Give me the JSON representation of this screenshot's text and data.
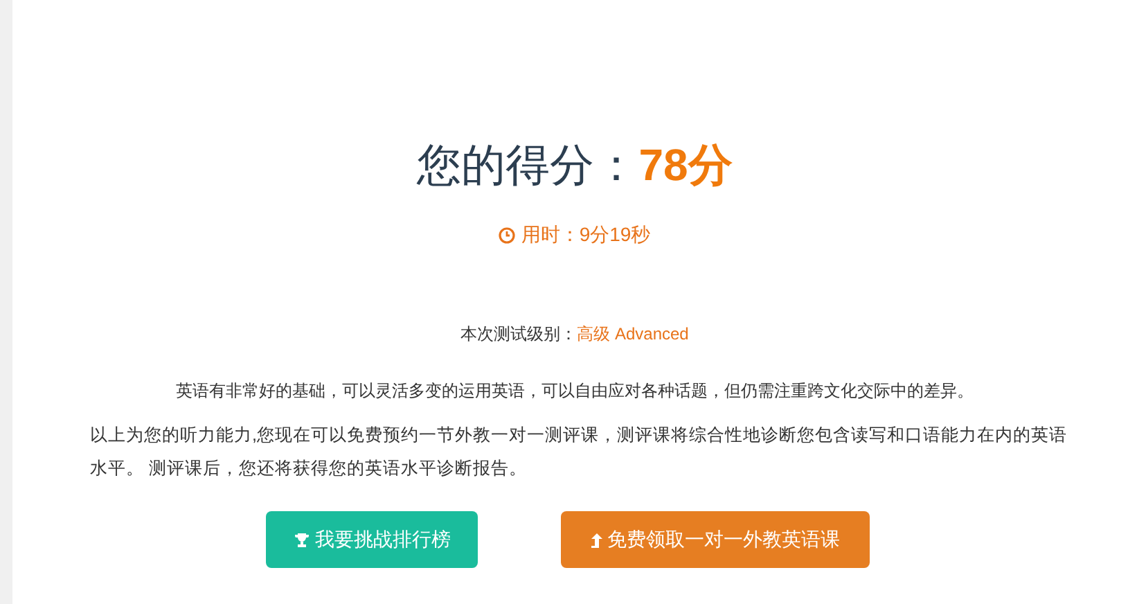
{
  "score": {
    "label": "您的得分：",
    "value": "78分"
  },
  "time": {
    "text": "用时：9分19秒"
  },
  "level": {
    "label": "本次测试级别：",
    "value": "高级 Advanced"
  },
  "description": "英语有非常好的基础，可以灵活多变的运用英语，可以自由应对各种话题，但仍需注重跨文化交际中的差异。",
  "paragraph_lines": [
    "以上为您的听力能力,您现在可以免费预约一节外教一对一测评课，测评课将综合性地诊断您包含读写和口语能力在内的英语",
    "水平。 测评课后，您还将获得您的英语水平诊断报告。"
  ],
  "buttons": [
    {
      "kind": "trophy",
      "label": "我要挑战排行榜"
    },
    {
      "kind": "upload",
      "label": "免费领取一对一外教英语课"
    }
  ]
}
